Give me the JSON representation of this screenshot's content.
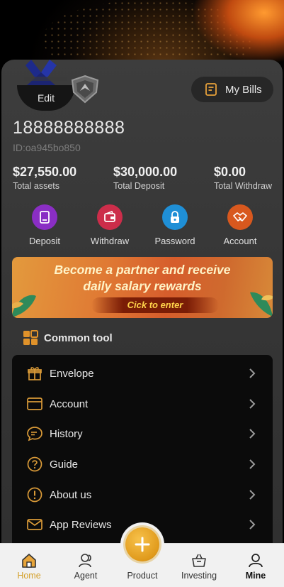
{
  "header": {
    "edit_label": "Edit",
    "bills_label": "My Bills"
  },
  "profile": {
    "phone": "18888888888",
    "user_id": "ID:oa945bo850"
  },
  "stats": [
    {
      "value": "$27,550.00",
      "label": "Total assets"
    },
    {
      "value": "$30,000.00",
      "label": "Total Deposit"
    },
    {
      "value": "$0.00",
      "label": "Total Withdraw"
    }
  ],
  "actions": [
    {
      "label": "Deposit",
      "icon": "deposit-icon",
      "color": "#8a2ec4"
    },
    {
      "label": "Withdraw",
      "icon": "wallet-icon",
      "color": "#cc2d4a"
    },
    {
      "label": "Password",
      "icon": "lock-icon",
      "color": "#1f8fd6"
    },
    {
      "label": "Account",
      "icon": "handshake-icon",
      "color": "#d8581e"
    }
  ],
  "banner": {
    "line1": "Become a partner and receive",
    "line2": "daily salary rewards",
    "cta": "Cick to enter"
  },
  "tools": {
    "title": "Common tool",
    "items": [
      {
        "label": "Envelope",
        "icon": "gift-icon"
      },
      {
        "label": "Account",
        "icon": "card-icon"
      },
      {
        "label": "History",
        "icon": "chat-icon"
      },
      {
        "label": "Guide",
        "icon": "question-icon"
      },
      {
        "label": "About us",
        "icon": "info-icon"
      },
      {
        "label": "App Reviews",
        "icon": "mail-icon"
      }
    ]
  },
  "tabbar": {
    "items": [
      {
        "label": "Home",
        "icon": "home-icon",
        "active": true
      },
      {
        "label": "Agent",
        "icon": "agent-icon",
        "active": false
      },
      {
        "label": "Product",
        "icon": "plus-icon",
        "active": false
      },
      {
        "label": "Investing",
        "icon": "basket-icon",
        "active": false
      },
      {
        "label": "Mine",
        "icon": "user-icon",
        "active": false
      }
    ]
  },
  "colors": {
    "accent": "#e0a02a",
    "card_bg": "#383838",
    "list_bg": "#0b0b0b"
  }
}
